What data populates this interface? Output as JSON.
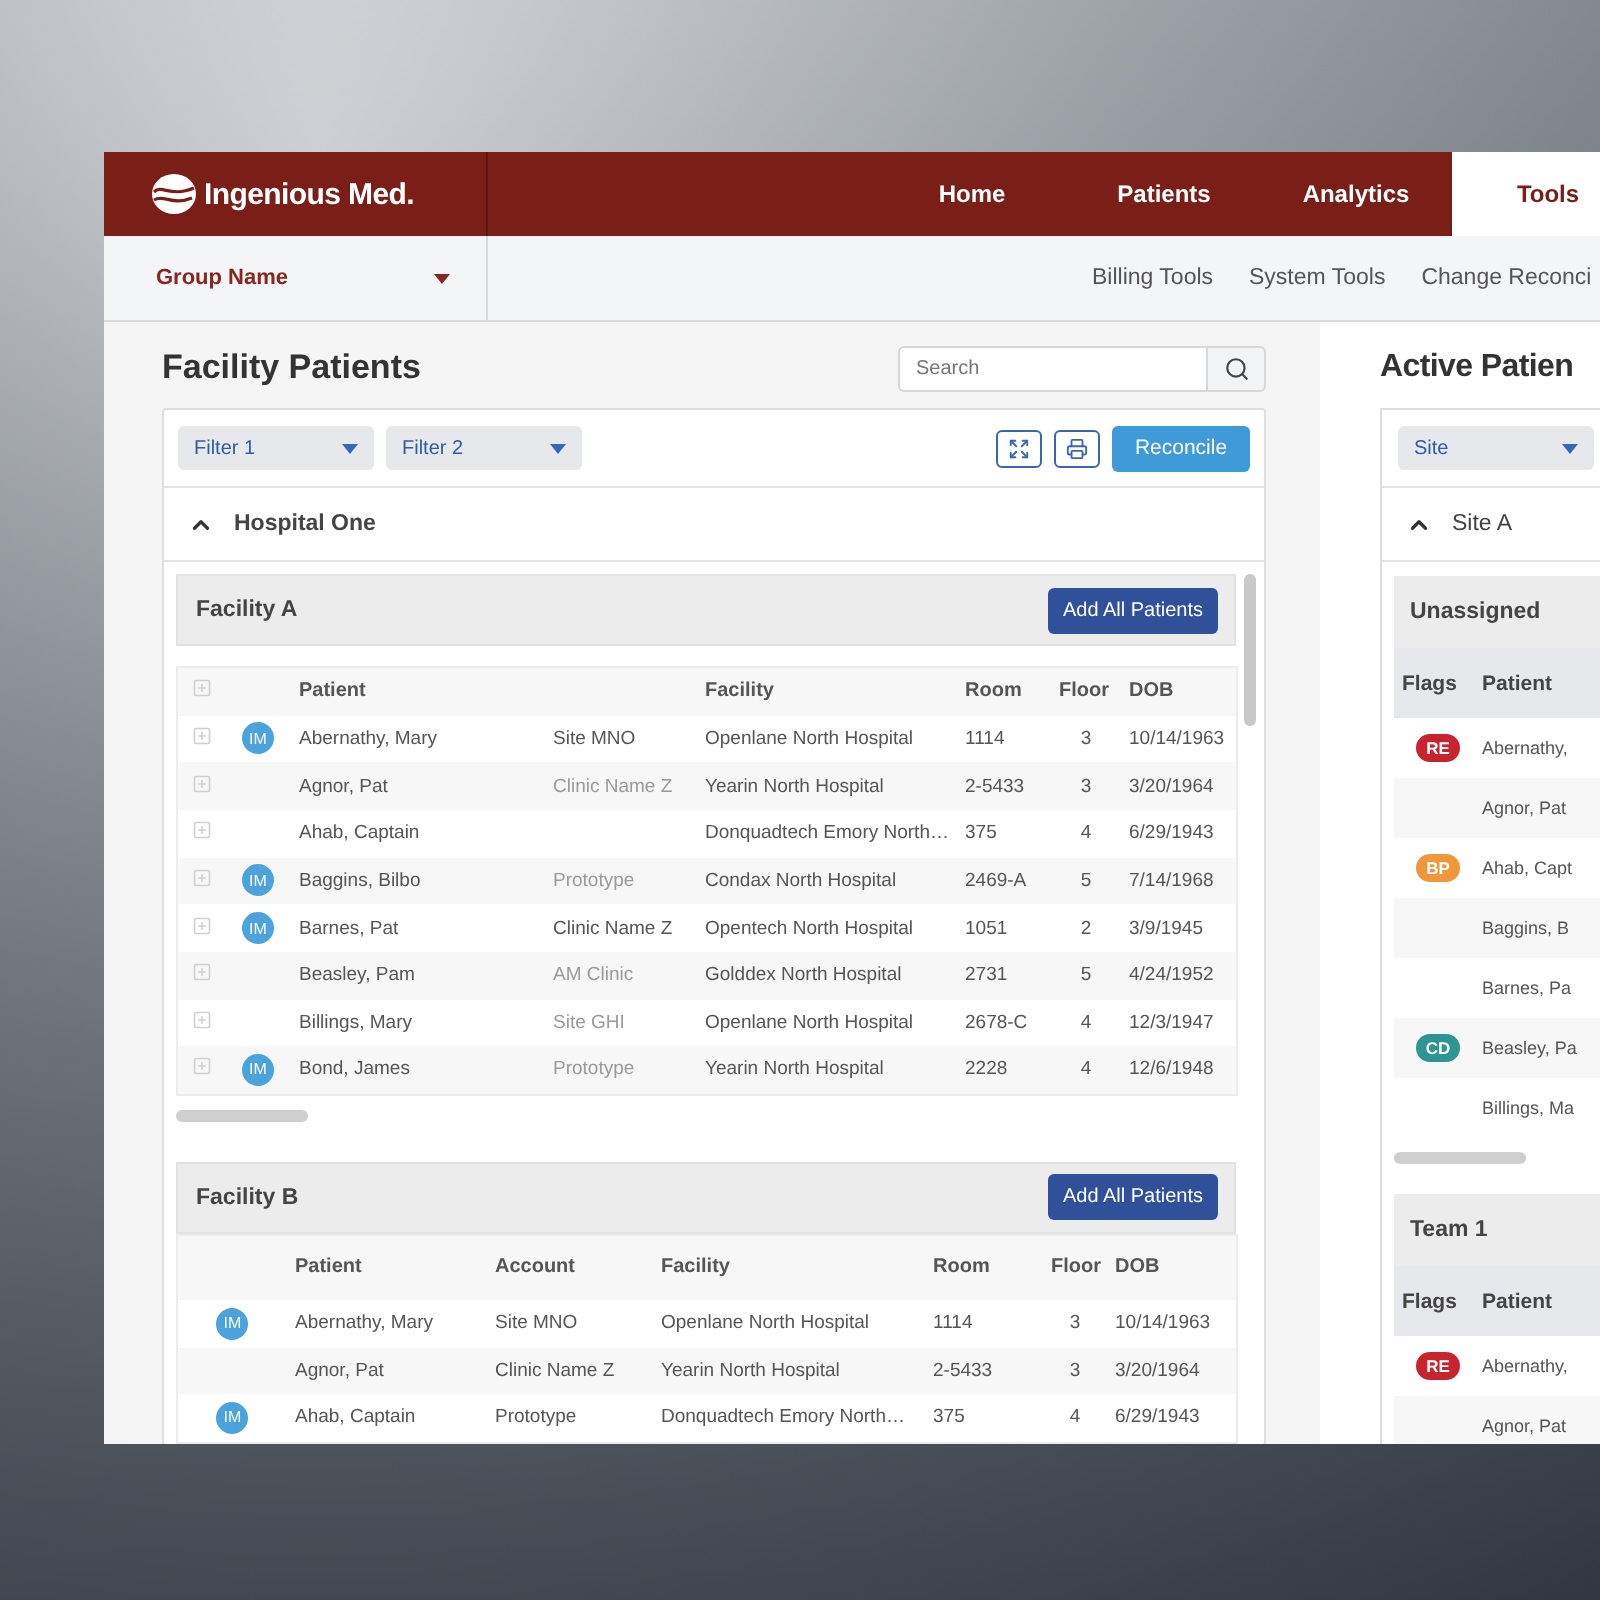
{
  "header": {
    "logo_text": "Ingenious Med.",
    "nav": [
      {
        "label": "Home",
        "selected": false
      },
      {
        "label": "Patients",
        "selected": false
      },
      {
        "label": "Analytics",
        "selected": false
      },
      {
        "label": "Tools",
        "selected": true
      }
    ]
  },
  "subnav": {
    "group": "Group Name",
    "links": [
      "Billing Tools",
      "System Tools",
      "Change Reconci"
    ]
  },
  "facility_panel": {
    "title": "Facility Patients",
    "search": {
      "placeholder": "Search"
    },
    "filters": [
      "Filter 1",
      "Filter 2"
    ],
    "reconcile": "Reconcile",
    "hospital": {
      "name": "Hospital One",
      "expanded": true
    },
    "facilities": [
      {
        "name": "Facility A",
        "button": "Add All Patients",
        "expandable": true,
        "columns": {
          "patient": "Patient",
          "facility": "Facility",
          "room": "Room",
          "floor": "Floor",
          "dob": "DOB"
        },
        "rows": [
          {
            "badge": "IM",
            "patient": "Abernathy, Mary",
            "account": "Site MNO",
            "account_muted": false,
            "facility": "Openlane North Hospital",
            "room": "1114",
            "floor": "3",
            "dob": "10/14/1963"
          },
          {
            "patient": "Agnor, Pat",
            "account": "Clinic Name Z",
            "account_muted": true,
            "facility": "Yearin North Hospital",
            "room": "2-5433",
            "floor": "3",
            "dob": "3/20/1964"
          },
          {
            "patient": "Ahab, Captain",
            "facility": "Donquadtech Emory North…",
            "room": "375",
            "floor": "4",
            "dob": "6/29/1943"
          },
          {
            "badge": "IM",
            "patient": "Baggins, Bilbo",
            "account": "Prototype",
            "account_muted": true,
            "facility": "Condax North Hospital",
            "room": "2469-A",
            "floor": "5",
            "dob": "7/14/1968"
          },
          {
            "badge": "IM",
            "patient": "Barnes, Pat",
            "account": "Clinic Name Z",
            "account_muted": false,
            "facility": "Opentech North Hospital",
            "room": "1051",
            "floor": "2",
            "dob": "3/9/1945"
          },
          {
            "patient": "Beasley, Pam",
            "account": "AM Clinic",
            "account_muted": true,
            "facility": "Golddex North Hospital",
            "room": "2731",
            "floor": "5",
            "dob": "4/24/1952"
          },
          {
            "patient": "Billings, Mary",
            "account": "Site GHI",
            "account_muted": true,
            "facility": "Openlane North Hospital",
            "room": "2678-C",
            "floor": "4",
            "dob": "12/3/1947"
          },
          {
            "badge": "IM",
            "patient": "Bond, James",
            "account": "Prototype",
            "account_muted": true,
            "facility": "Yearin North Hospital",
            "room": "2228",
            "floor": "4",
            "dob": "12/6/1948"
          }
        ]
      },
      {
        "name": "Facility B",
        "button": "Add All Patients",
        "expandable": false,
        "columns": {
          "patient": "Patient",
          "account": "Account",
          "facility": "Facility",
          "room": "Room",
          "floor": "Floor",
          "dob": "DOB"
        },
        "rows": [
          {
            "badge": "IM",
            "patient": "Abernathy, Mary",
            "account": "Site MNO",
            "account_muted": false,
            "facility": "Openlane North Hospital",
            "room": "1114",
            "floor": "3",
            "dob": "10/14/1963"
          },
          {
            "patient": "Agnor, Pat",
            "account": "Clinic Name Z",
            "account_muted": false,
            "facility": "Yearin North Hospital",
            "room": "2-5433",
            "floor": "3",
            "dob": "3/20/1964"
          },
          {
            "badge": "IM",
            "patient": "Ahab, Captain",
            "account": "Prototype",
            "account_muted": false,
            "facility": "Donquadtech Emory North…",
            "room": "375",
            "floor": "4",
            "dob": "6/29/1943"
          }
        ]
      }
    ]
  },
  "active_panel": {
    "title": "Active Patien",
    "filter": "Site",
    "site": {
      "name": "Site A",
      "expanded": true
    },
    "groups": [
      {
        "name": "Unassigned",
        "columns": [
          "Flags",
          "Patient"
        ],
        "rows": [
          {
            "flag": "RE",
            "color": "#c8242f",
            "patient": "Abernathy,"
          },
          {
            "patient": "Agnor, Pat"
          },
          {
            "flag": "BP",
            "color": "#f0973a",
            "patient": "Ahab, Capt"
          },
          {
            "patient": "Baggins, B"
          },
          {
            "patient": "Barnes, Pa"
          },
          {
            "flag": "CD",
            "color": "#2e9590",
            "patient": "Beasley, Pa"
          },
          {
            "patient": "Billings, Ma"
          }
        ]
      },
      {
        "name": "Team 1",
        "columns": [
          "Flags",
          "Patient"
        ],
        "rows": [
          {
            "flag": "RE",
            "color": "#c8242f",
            "patient": "Abernathy,"
          },
          {
            "patient": "Agnor, Pat"
          }
        ]
      }
    ]
  }
}
